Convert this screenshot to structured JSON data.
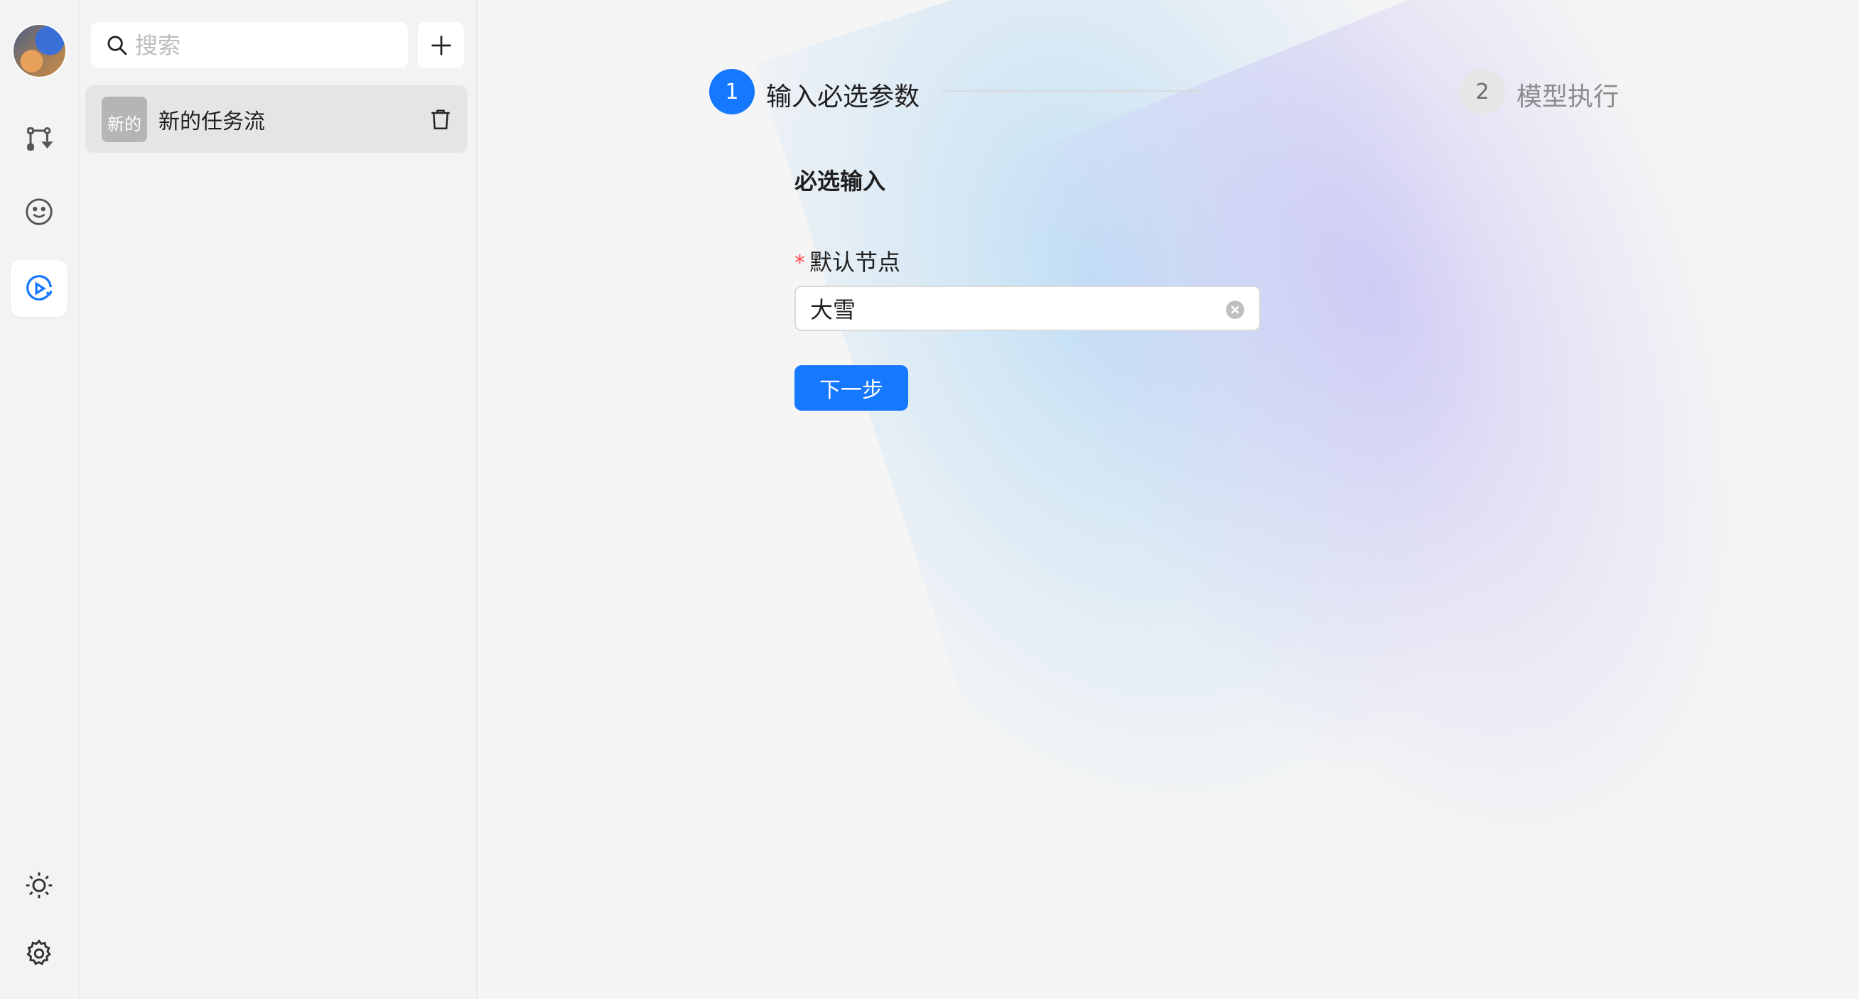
{
  "rail": {
    "items": [
      {
        "name": "workflow",
        "icon": "workflow-icon"
      },
      {
        "name": "smiley",
        "icon": "smiley-icon"
      },
      {
        "name": "run",
        "icon": "play-loop-icon",
        "active": true
      }
    ],
    "bottom": [
      {
        "name": "theme",
        "icon": "sun-icon"
      },
      {
        "name": "settings",
        "icon": "gear-icon"
      }
    ]
  },
  "sidebar": {
    "search_placeholder": "搜索",
    "sessions": [
      {
        "thumb": "新的",
        "title": "新的任务流"
      }
    ]
  },
  "steps": [
    {
      "number": "1",
      "title": "输入必选参数",
      "status": "active"
    },
    {
      "number": "2",
      "title": "模型执行",
      "status": "wait"
    }
  ],
  "form": {
    "title": "必选输入",
    "field_required_mark": "*",
    "field_label": "默认节点",
    "field_value": "大雪",
    "next_label": "下一步"
  },
  "colors": {
    "primary": "#1677ff",
    "required": "#ff4d4f"
  }
}
